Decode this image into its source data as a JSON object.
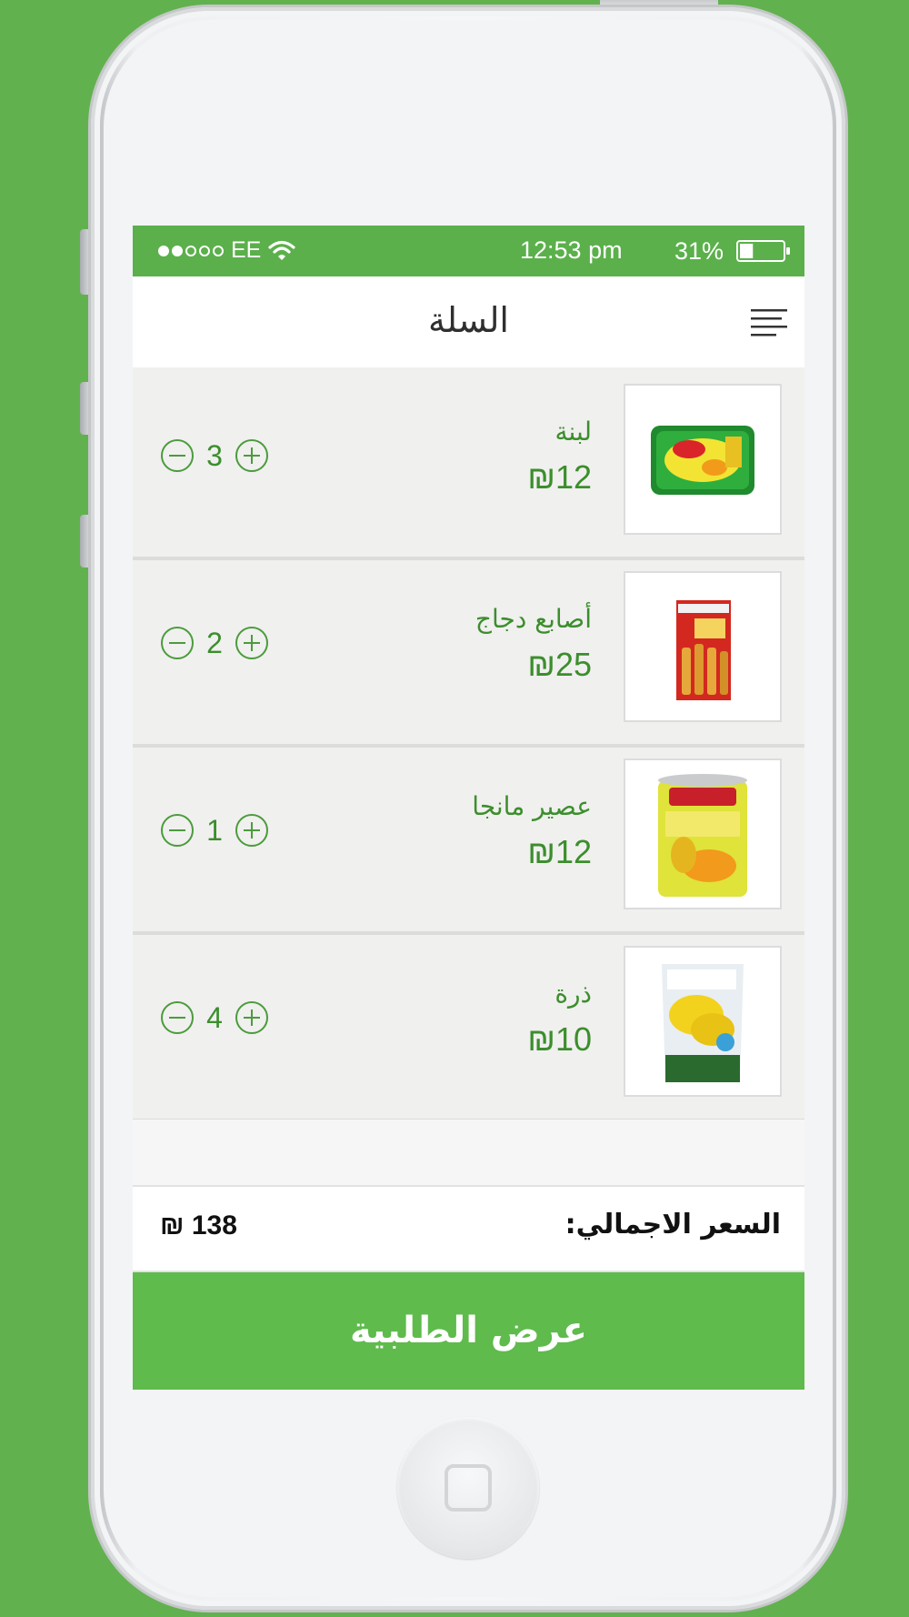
{
  "status_bar": {
    "carrier": "EE",
    "time": "12:53 pm",
    "battery": "31%",
    "battery_level": 0.31
  },
  "header": {
    "title": "السلة"
  },
  "cart_items": [
    {
      "name": "لبنة",
      "price": "₪12",
      "quantity": "3",
      "image": "vim-dishwash-bar"
    },
    {
      "name": "أصابع دجاج",
      "price": "₪25",
      "quantity": "2",
      "image": "chicken-fingers-box"
    },
    {
      "name": "عصير مانجا",
      "price": "₪12",
      "quantity": "1",
      "image": "mango-pulp-can"
    },
    {
      "name": "ذرة",
      "price": "₪10",
      "quantity": "4",
      "image": "sweet-corn-bag"
    }
  ],
  "summary": {
    "total_label": "السعر الاجمالي:",
    "total_value": "₪ 138"
  },
  "actions": {
    "submit_label": "عرض الطلبية"
  },
  "colors": {
    "brand": "#5bb04b",
    "text_green": "#3c8e2c",
    "background": "#62b14f"
  }
}
